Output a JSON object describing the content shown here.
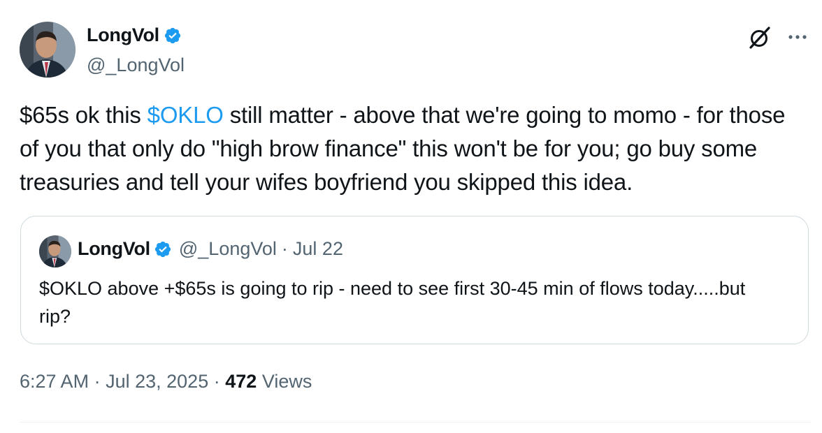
{
  "author": {
    "name": "LongVol",
    "handle": "@_LongVol",
    "verified_color": "#1d9bf0"
  },
  "tweet": {
    "text_before": "$65s ok this ",
    "cashtag": "$OKLO",
    "text_after": " still matter - above that we're going to momo - for those of you that only do \"high brow finance\" this won't be for you; go buy some treasuries and tell your wifes boyfriend you skipped this idea.",
    "time": "6:27 AM",
    "date": "Jul 23, 2025",
    "views_count": "472",
    "views_label": "Views"
  },
  "quote": {
    "name": "LongVol",
    "handle": "@_LongVol",
    "separator": "·",
    "date": "Jul 22",
    "text": "$OKLO above +$65s is going to rip - need to see first 30-45 min of flows today.....but rip?"
  },
  "icons": {
    "grok": "grok-icon",
    "more": "more-icon",
    "verified": "verified-badge-icon"
  },
  "colors": {
    "accent": "#1d9bf0",
    "text": "#0f1419",
    "muted": "#536471",
    "border": "#cfd9de"
  },
  "meta_separator": "·"
}
